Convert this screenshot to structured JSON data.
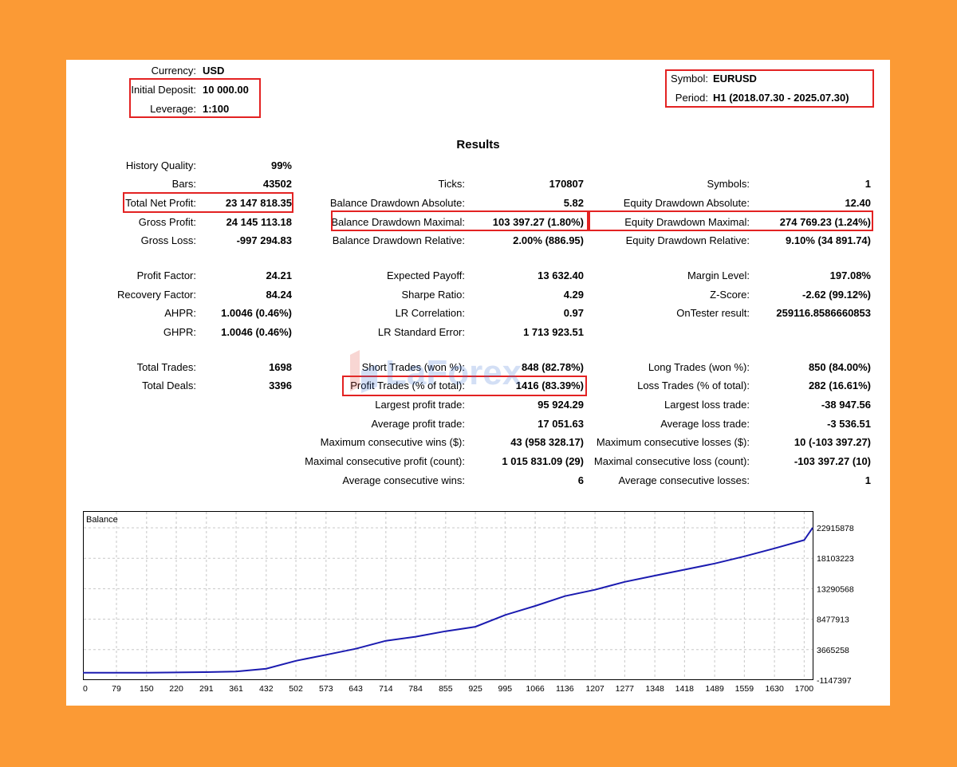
{
  "header": {
    "currency_label": "Currency:",
    "currency": "USD",
    "deposit_label": "Initial Deposit:",
    "deposit": "10 000.00",
    "leverage_label": "Leverage:",
    "leverage": "1:100",
    "symbol_label": "Symbol:",
    "symbol": "EURUSD",
    "period_label": "Period:",
    "period": "H1 (2018.07.30 - 2025.07.30)"
  },
  "results_title": "Results",
  "col1": [
    {
      "label": "History Quality:",
      "value": "99%"
    },
    {
      "label": "Bars:",
      "value": "43502"
    },
    {
      "label": "Total Net Profit:",
      "value": "23 147 818.35"
    },
    {
      "label": "Gross Profit:",
      "value": "24 145 113.18"
    },
    {
      "label": "Gross Loss:",
      "value": "-997 294.83"
    },
    {
      "label": "Profit Factor:",
      "value": "24.21"
    },
    {
      "label": "Recovery Factor:",
      "value": "84.24"
    },
    {
      "label": "AHPR:",
      "value": "1.0046 (0.46%)"
    },
    {
      "label": "GHPR:",
      "value": "1.0046 (0.46%)"
    },
    {
      "label": "Total Trades:",
      "value": "1698"
    },
    {
      "label": "Total Deals:",
      "value": "3396"
    }
  ],
  "col2": [
    {
      "label": "Ticks:",
      "value": "170807"
    },
    {
      "label": "Balance Drawdown Absolute:",
      "value": "5.82"
    },
    {
      "label": "Balance Drawdown Maximal:",
      "value": "103 397.27 (1.80%)"
    },
    {
      "label": "Balance Drawdown Relative:",
      "value": "2.00% (886.95)"
    },
    {
      "label": "Expected Payoff:",
      "value": "13 632.40"
    },
    {
      "label": "Sharpe Ratio:",
      "value": "4.29"
    },
    {
      "label": "LR Correlation:",
      "value": "0.97"
    },
    {
      "label": "LR Standard Error:",
      "value": "1 713 923.51"
    },
    {
      "label": "Short Trades (won %):",
      "value": "848 (82.78%)"
    },
    {
      "label": "Profit Trades (% of total):",
      "value": "1416 (83.39%)"
    },
    {
      "label": "Largest profit trade:",
      "value": "95 924.29"
    },
    {
      "label": "Average profit trade:",
      "value": "17 051.63"
    },
    {
      "label": "Maximum consecutive wins ($):",
      "value": "43 (958 328.17)"
    },
    {
      "label": "Maximal consecutive profit (count):",
      "value": "1 015 831.09 (29)"
    },
    {
      "label": "Average consecutive wins:",
      "value": "6"
    }
  ],
  "col3": [
    {
      "label": "Symbols:",
      "value": "1"
    },
    {
      "label": "Equity Drawdown Absolute:",
      "value": "12.40"
    },
    {
      "label": "Equity Drawdown Maximal:",
      "value": "274 769.23 (1.24%)"
    },
    {
      "label": "Equity Drawdown Relative:",
      "value": "9.10% (34 891.74)"
    },
    {
      "label": "Margin Level:",
      "value": "197.08%"
    },
    {
      "label": "Z-Score:",
      "value": "-2.62 (99.12%)"
    },
    {
      "label": "OnTester result:",
      "value": "259116.8586660853"
    },
    {
      "label": "Long Trades (won %):",
      "value": "850 (84.00%)"
    },
    {
      "label": "Loss Trades (% of total):",
      "value": "282 (16.61%)"
    },
    {
      "label": "Largest loss trade:",
      "value": "-38 947.56"
    },
    {
      "label": "Average loss trade:",
      "value": "-3 536.51"
    },
    {
      "label": "Maximum consecutive losses ($):",
      "value": "10 (-103 397.27)"
    },
    {
      "label": "Maximal consecutive loss (count):",
      "value": "-103 397.27 (10)"
    },
    {
      "label": "Average consecutive losses:",
      "value": "1"
    }
  ],
  "watermark": "LaForex",
  "colors": {
    "highlight_box": "#e32222",
    "balance_line": "#1b1bb0",
    "background": "#fb9a35"
  },
  "chart_data": {
    "type": "line",
    "title": "Balance",
    "series": [
      {
        "x": [
          0,
          79,
          150,
          220,
          291,
          361,
          432,
          502,
          573,
          643,
          714,
          784,
          855,
          925,
          995,
          1066,
          1136,
          1207,
          1277,
          1348,
          1418,
          1489,
          1559,
          1630,
          1700,
          1720
        ],
        "values": [
          10000,
          10000,
          20000,
          60000,
          110000,
          200000,
          660000,
          1900000,
          2850000,
          3800000,
          5060000,
          5700000,
          6570000,
          7280000,
          9130000,
          10570000,
          12120000,
          13130000,
          14380000,
          15360000,
          16300000,
          17270000,
          18400000,
          19670000,
          20980000,
          22915878
        ]
      }
    ],
    "x_ticks": [
      0,
      79,
      150,
      220,
      291,
      361,
      432,
      502,
      573,
      643,
      714,
      784,
      855,
      925,
      995,
      1066,
      1136,
      1207,
      1277,
      1348,
      1418,
      1489,
      1559,
      1630,
      1700
    ],
    "y_ticks": [
      22915878,
      18103223,
      13290568,
      8477913,
      3665258,
      -1147397
    ],
    "xlim": [
      0,
      1720
    ],
    "ylim": [
      -1147397,
      25000000
    ],
    "grid": true
  }
}
